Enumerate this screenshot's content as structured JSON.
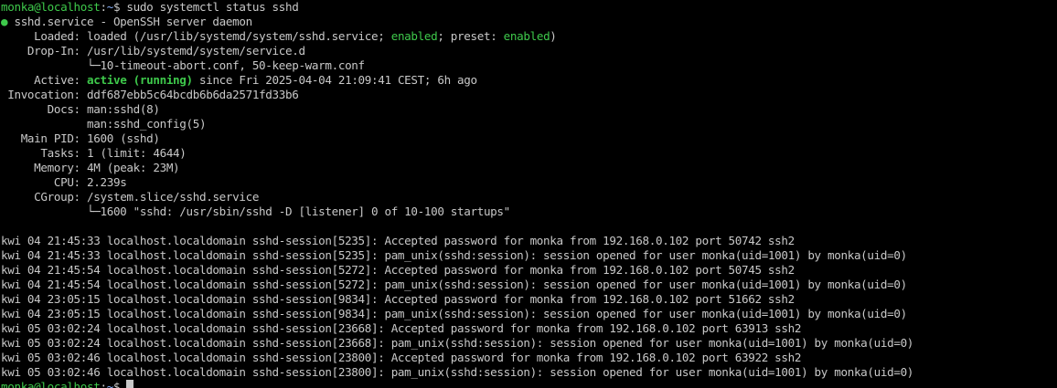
{
  "terminal": {
    "prompt": {
      "user_host": "monka@localhost",
      "sep": ":",
      "path": "~",
      "symbol": "$ "
    },
    "command": "sudo systemctl status sshd",
    "unit": {
      "bullet": "●",
      "title": " sshd.service - OpenSSH server daemon"
    },
    "loaded": {
      "label": "     Loaded: ",
      "text1": "loaded (/usr/lib/systemd/system/sshd.service; ",
      "enabled1": "enabled",
      "text2": "; preset: ",
      "enabled2": "enabled",
      "text3": ")"
    },
    "dropin": {
      "label": "    Drop-In: ",
      "path": "/usr/lib/systemd/system/service.d",
      "files": "             └─10-timeout-abort.conf, 50-keep-warm.conf"
    },
    "active": {
      "label": "     Active: ",
      "state": "active (running)",
      "since": " since Fri 2025-04-04 21:09:41 CEST; 6h ago"
    },
    "invocation": {
      "label": " Invocation: ",
      "value": "ddf687ebb5c64bcdb6b6da2571fd33b6"
    },
    "docs": {
      "label": "       Docs: ",
      "value1": "man:sshd(8)",
      "value2": "             man:sshd_config(5)"
    },
    "main_pid": {
      "label": "   Main PID: ",
      "value": "1600 (sshd)"
    },
    "tasks": {
      "label": "      Tasks: ",
      "value": "1 (limit: 4644)"
    },
    "memory": {
      "label": "     Memory: ",
      "value": "4M (peak: 23M)"
    },
    "cpu": {
      "label": "        CPU: ",
      "value": "2.239s"
    },
    "cgroup": {
      "label": "     CGroup: ",
      "value": "/system.slice/sshd.service",
      "child": "             └─1600 \"sshd: /usr/sbin/sshd -D [listener] 0 of 10-100 startups\""
    },
    "log": [
      "kwi 04 21:45:33 localhost.localdomain sshd-session[5235]: Accepted password for monka from 192.168.0.102 port 50742 ssh2",
      "kwi 04 21:45:33 localhost.localdomain sshd-session[5235]: pam_unix(sshd:session): session opened for user monka(uid=1001) by monka(uid=0)",
      "kwi 04 21:45:54 localhost.localdomain sshd-session[5272]: Accepted password for monka from 192.168.0.102 port 50745 ssh2",
      "kwi 04 21:45:54 localhost.localdomain sshd-session[5272]: pam_unix(sshd:session): session opened for user monka(uid=1001) by monka(uid=0)",
      "kwi 04 23:05:15 localhost.localdomain sshd-session[9834]: Accepted password for monka from 192.168.0.102 port 51662 ssh2",
      "kwi 04 23:05:15 localhost.localdomain sshd-session[9834]: pam_unix(sshd:session): session opened for user monka(uid=1001) by monka(uid=0)",
      "kwi 05 03:02:24 localhost.localdomain sshd-session[23668]: Accepted password for monka from 192.168.0.102 port 63913 ssh2",
      "kwi 05 03:02:24 localhost.localdomain sshd-session[23668]: pam_unix(sshd:session): session opened for user monka(uid=1001) by monka(uid=0)",
      "kwi 05 03:02:46 localhost.localdomain sshd-session[23800]: Accepted password for monka from 192.168.0.102 port 63922 ssh2",
      "kwi 05 03:02:46 localhost.localdomain sshd-session[23800]: pam_unix(sshd:session): session opened for user monka(uid=1001) by monka(uid=0)"
    ],
    "colors": {
      "background": "#000000",
      "foreground": "#c8c8c8",
      "green": "#3ec94b",
      "blue": "#8ab4ff"
    }
  }
}
